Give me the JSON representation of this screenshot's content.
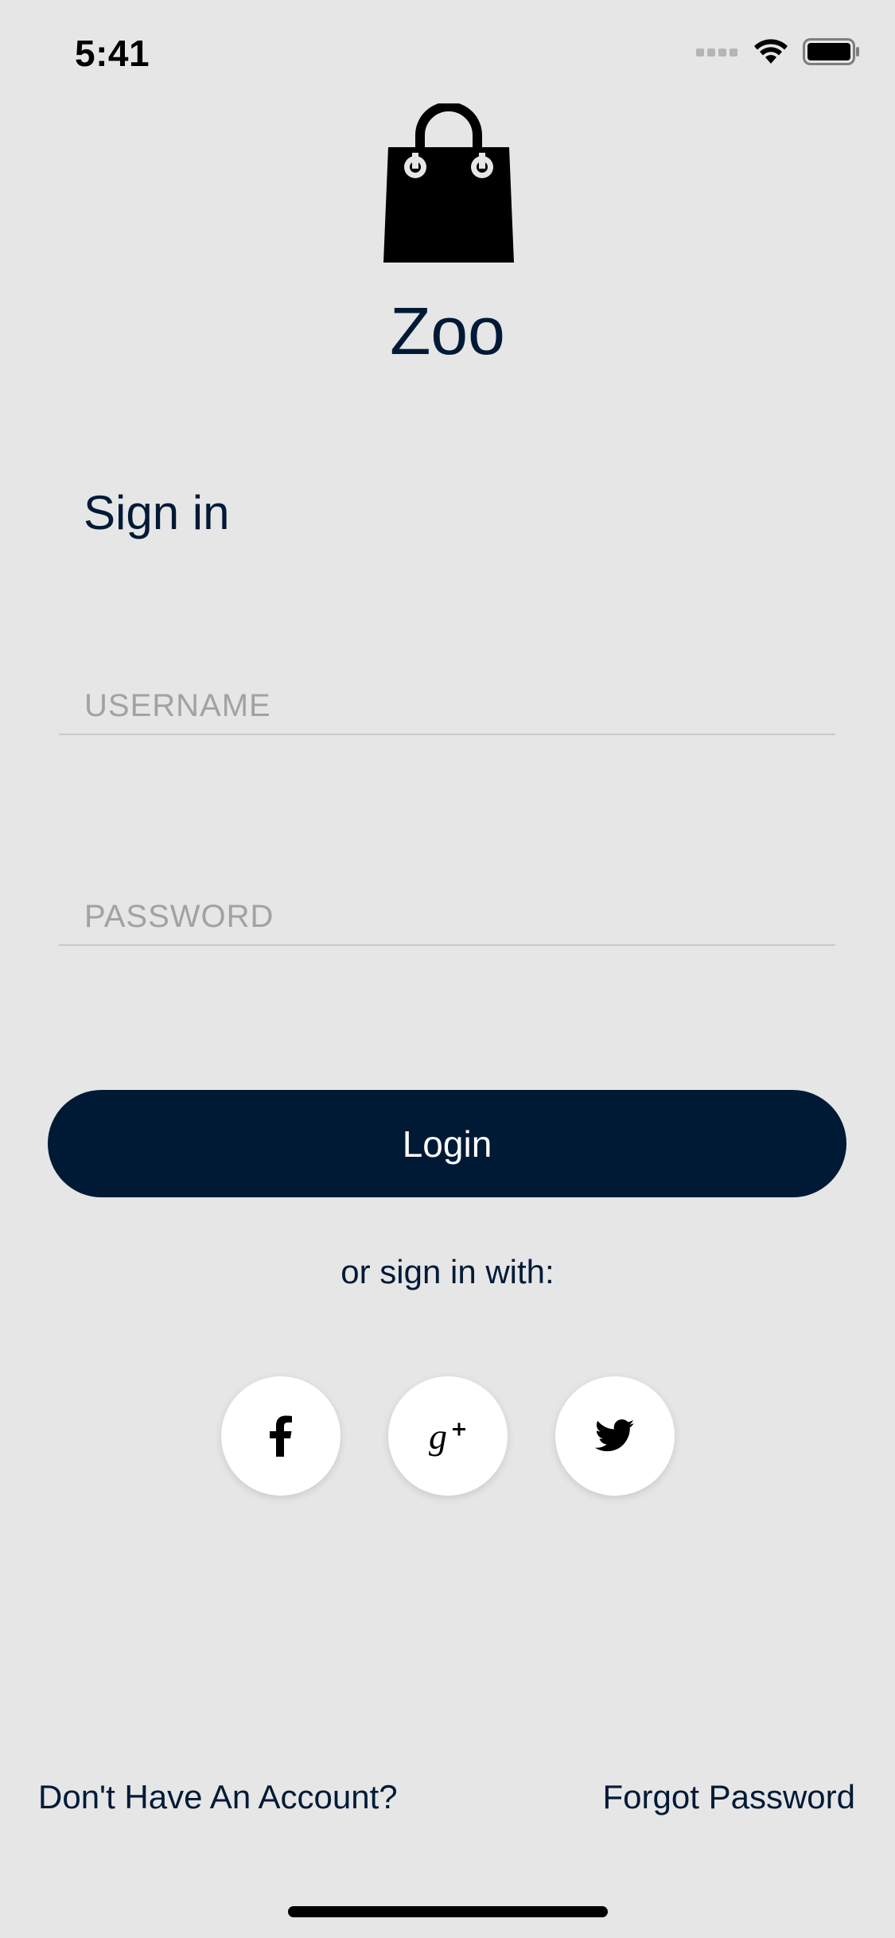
{
  "status_bar": {
    "time": "5:41"
  },
  "app": {
    "name": "Zoo",
    "logo_icon": "shopping-bag-icon"
  },
  "signin": {
    "title": "Sign in",
    "username_placeholder": "USERNAME",
    "username_value": "",
    "password_placeholder": "PASSWORD",
    "password_value": "",
    "login_label": "Login",
    "alt_text": "or sign in with:",
    "social": [
      {
        "icon": "facebook-icon"
      },
      {
        "icon": "google-plus-icon"
      },
      {
        "icon": "twitter-icon"
      }
    ]
  },
  "footer": {
    "signup_label": "Don't Have An Account?",
    "forgot_label": "Forgot Password"
  },
  "colors": {
    "background": "#e6e6e7",
    "primary": "#001a36",
    "placeholder": "#a2a2a5"
  }
}
